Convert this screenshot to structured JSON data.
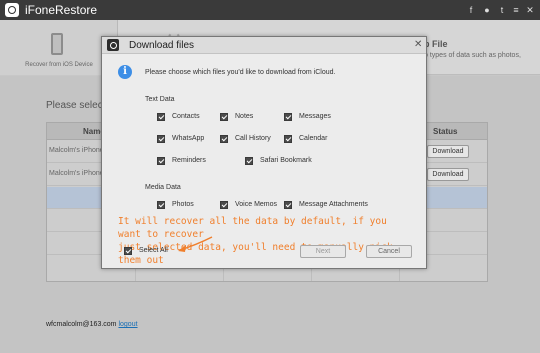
{
  "app": {
    "title": "iFoneRestore",
    "title_icons": [
      "facebook-icon",
      "chat-icon",
      "twitter-icon",
      "menu-icon",
      "minimize-icon",
      "close-icon"
    ]
  },
  "tabs": {
    "device_label": "Recover from iOS Device",
    "right_title": "p File",
    "right_desc": "p types of data such as photos,"
  },
  "main": {
    "prompt": "Please select a",
    "columns": {
      "name": "Name",
      "status": "Status"
    },
    "rows": [
      {
        "name": "Malcolm's iPhone",
        "action": "Download"
      },
      {
        "name": "Malcolm's iPhone",
        "action": "Download"
      }
    ],
    "account_email": "wfcmalcolm@163.com",
    "logout": "logout"
  },
  "dialog": {
    "title": "Download files",
    "info": "Please choose which files you'd like to download from iCloud.",
    "text_data_label": "Text Data",
    "text_items": [
      "Contacts",
      "Notes",
      "Messages",
      "WhatsApp",
      "Call History",
      "Calendar",
      "Reminders",
      "Safari Bookmark"
    ],
    "media_data_label": "Media Data",
    "media_items": [
      "Photos",
      "Voice Memos",
      "Message Attachments"
    ],
    "annotation_line1": "It will recover all the data by default, if you want to recover",
    "annotation_line2": "just selected data, you'll need to manually pick them out",
    "select_all": "Select All",
    "next": "Next",
    "cancel": "Cancel"
  },
  "colors": {
    "titlebar": "#3a3a3a",
    "annotation": "#f07f2c",
    "info_icon": "#3d8ee6"
  }
}
